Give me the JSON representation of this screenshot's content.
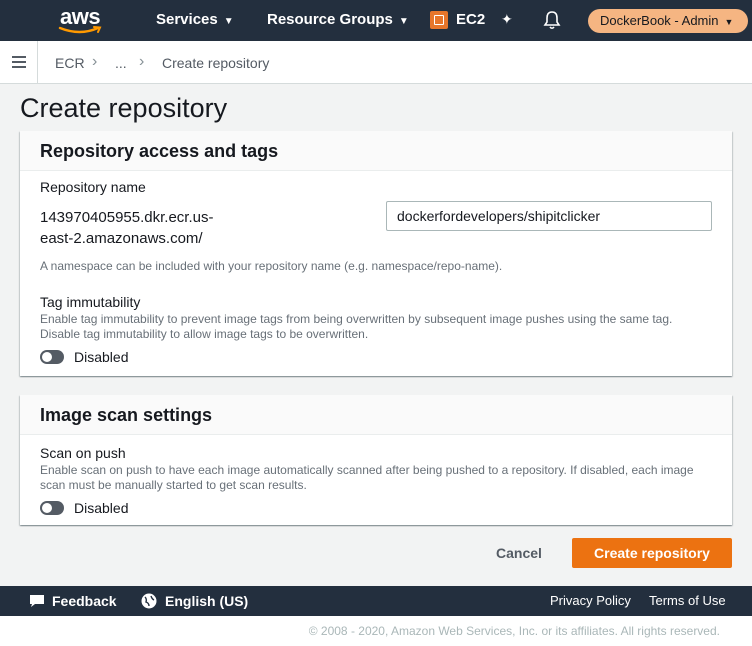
{
  "topnav": {
    "logo_text": "aws",
    "services_label": "Services",
    "resource_groups_label": "Resource Groups",
    "ec2_label": "EC2",
    "account_label": "DockerBook - Admin"
  },
  "breadcrumb": {
    "items": [
      "ECR",
      "...",
      "Create repository"
    ]
  },
  "page": {
    "title": "Create repository"
  },
  "access_panel": {
    "heading": "Repository access and tags",
    "repo_name_label": "Repository name",
    "uri_line1": "143970405955.dkr.ecr.us-",
    "uri_line2": "east-2.amazonaws.com/",
    "repo_name_value": "dockerfordevelopers/shipitclicker",
    "namespace_hint": "A namespace can be included with your repository name (e.g. namespace/repo-name).",
    "tag_label": "Tag immutability",
    "tag_desc_line1": "Enable tag immutability to prevent image tags from being overwritten by subsequent image pushes using the same tag.",
    "tag_desc_line2": "Disable tag immutability to allow image tags to be overwritten.",
    "tag_toggle_state": "Disabled"
  },
  "scan_panel": {
    "heading": "Image scan settings",
    "scan_label": "Scan on push",
    "scan_desc_line1": "Enable scan on push to have each image automatically scanned after being pushed to a repository. If disabled, each image",
    "scan_desc_line2": "scan must be manually started to get scan results.",
    "scan_toggle_state": "Disabled"
  },
  "actions": {
    "cancel_label": "Cancel",
    "create_label": "Create repository"
  },
  "footer": {
    "feedback_label": "Feedback",
    "language_label": "English (US)",
    "privacy_label": "Privacy Policy",
    "terms_label": "Terms of Use",
    "copyright": "© 2008 - 2020, Amazon Web Services, Inc. or its affiliates. All rights reserved."
  },
  "colors": {
    "nav_bg": "#232f3e",
    "primary": "#ec7211",
    "account_pill": "#f5b582",
    "page_bg": "#f2f3f3"
  }
}
